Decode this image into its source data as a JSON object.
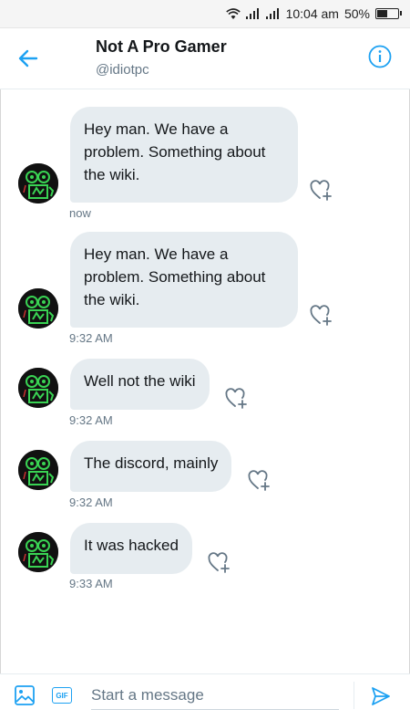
{
  "status_bar": {
    "time": "10:04 am",
    "battery": "50%",
    "battery_level": 0.5
  },
  "header": {
    "title": "Not A Pro Gamer",
    "handle": "@idiotpc"
  },
  "messages": [
    {
      "text": "Hey man. We have a problem. Something about the wiki.",
      "time": "now"
    },
    {
      "text": "Hey man. We have a problem. Something about the wiki.",
      "time": "9:32 AM"
    },
    {
      "text": "Well not the wiki",
      "time": "9:32 AM"
    },
    {
      "text": "The discord, mainly",
      "time": "9:32 AM"
    },
    {
      "text": "It was hacked",
      "time": "9:33 AM"
    }
  ],
  "compose": {
    "placeholder": "Start a message",
    "gif_label": "GIF"
  },
  "colors": {
    "accent": "#1da1f2",
    "bubble": "#e6ecf0",
    "avatar_art": "#39d353"
  }
}
